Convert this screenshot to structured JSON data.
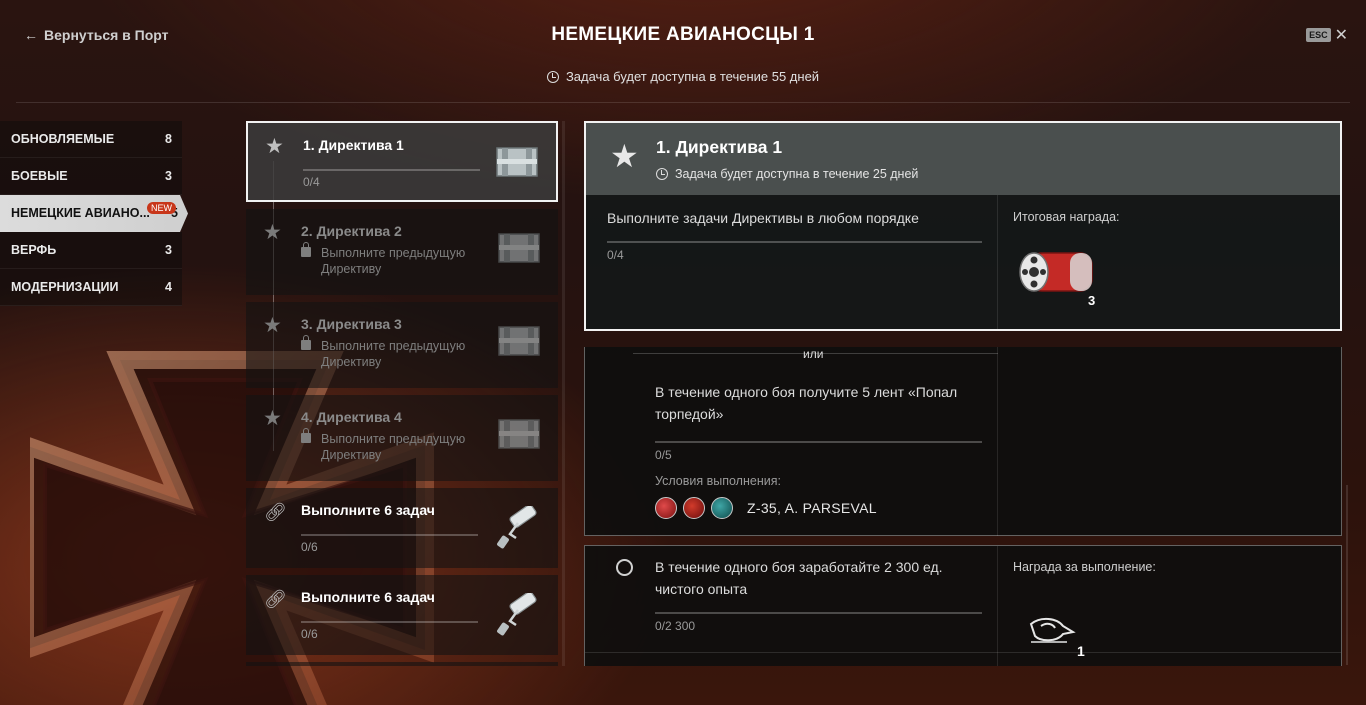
{
  "header": {
    "back_label": "Вернуться в Порт",
    "title": "НЕМЕЦКИЕ АВИАНОСЦЫ 1",
    "esc_label": "ESC",
    "availability": "Задача будет доступна в течение 55 дней"
  },
  "categories": [
    {
      "label": "ОБНОВЛЯЕМЫЕ",
      "count": "8"
    },
    {
      "label": "БОЕВЫЕ",
      "count": "3"
    },
    {
      "label": "НЕМЕЦКИЕ АВИАНО...",
      "count": "5",
      "badge": "NEW",
      "active": true
    },
    {
      "label": "ВЕРФЬ",
      "count": "3"
    },
    {
      "label": "МОДЕРНИЗАЦИИ",
      "count": "4"
    }
  ],
  "directives": [
    {
      "title": "1. Директива 1",
      "progress": "0/4",
      "state": "active",
      "icon": "supply-box-icon"
    },
    {
      "title": "2. Директива 2",
      "lock_text": "Выполните предыдущую Директиву",
      "state": "locked",
      "icon": "supply-box-icon"
    },
    {
      "title": "3. Директива 3",
      "lock_text": "Выполните предыдущую Директиву",
      "state": "locked",
      "icon": "supply-box-icon"
    },
    {
      "title": "4. Директива 4",
      "lock_text": "Выполните предыдущую Директиву",
      "state": "locked",
      "icon": "supply-box-icon"
    },
    {
      "title": "Выполните 6 задач",
      "progress": "0/6",
      "state": "chain",
      "icon": "paint-roller-icon"
    },
    {
      "title": "Выполните 6 задач",
      "progress": "0/6",
      "state": "chain",
      "icon": "paint-roller-icon"
    }
  ],
  "detail": {
    "title": "1. Директива 1",
    "availability": "Задача будет доступна в течение 25 дней",
    "task": "Выполните задачи Директивы в любом порядке",
    "progress": "0/4",
    "reward_label": "Итоговая награда:",
    "reward_count": "3",
    "reward_icon": "camouflage-can-icon"
  },
  "subtask_or": {
    "or_label": "или",
    "task": "В течение одного боя получите 5 лент «Попал торпедой»",
    "progress": "0/5",
    "conditions_label": "Условия выполнения:",
    "ships": "Z-35, A. PARSEVAL"
  },
  "subtask_xp": {
    "task": "В течение одного боя заработайте 2 300 ед. чистого опыта",
    "progress": "0/2 300",
    "reward_label": "Награда за выполнение:",
    "reward_count": "1",
    "reward_icon": "eagle-patch-icon"
  },
  "colors": {
    "accent_new": "#c8361a",
    "active_border": "#f2f2f2",
    "header_bg": "#4a4f4e"
  }
}
